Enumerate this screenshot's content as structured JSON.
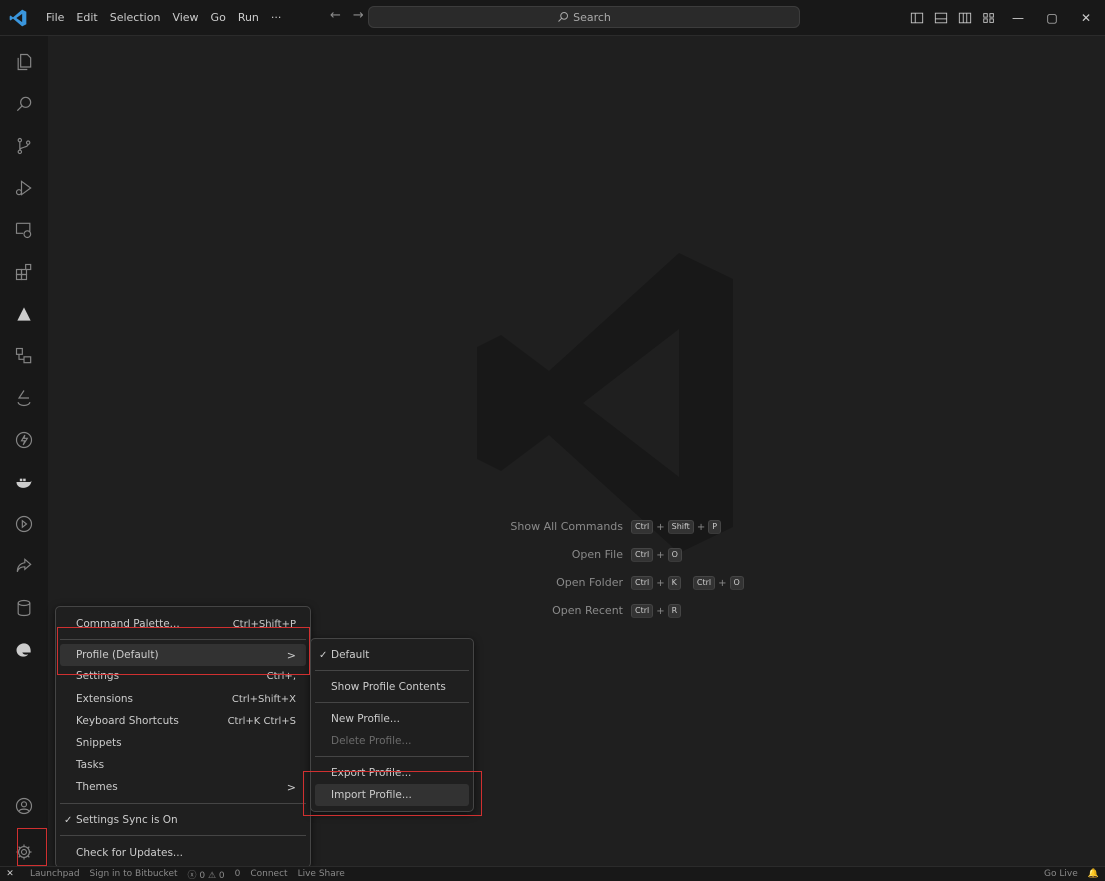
{
  "menubar": {
    "items": [
      "File",
      "Edit",
      "Selection",
      "View",
      "Go",
      "Run",
      "···"
    ],
    "back_arrow": "←",
    "forward_arrow": "→"
  },
  "search": {
    "label": "Search"
  },
  "window_controls": {
    "minimize": "—",
    "maximize": "▢",
    "close": "✕"
  },
  "activity_icons": [
    "explorer-icon",
    "search-icon",
    "source-control-icon",
    "run-debug-icon",
    "remote-explorer-icon",
    "extensions-icon",
    "azure-icon",
    "deployment-icon",
    "accessibility-icon",
    "lightning-icon",
    "docker-icon",
    "play-circle-icon",
    "live-share-icon",
    "database-icon",
    "edge-icon",
    "account-icon",
    "manage-gear-icon"
  ],
  "shortcuts": [
    {
      "label": "Show All Commands",
      "keys": [
        [
          "Ctrl",
          "Shift",
          "P"
        ]
      ]
    },
    {
      "label": "Open File",
      "keys": [
        [
          "Ctrl",
          "O"
        ]
      ]
    },
    {
      "label": "Open Folder",
      "keys": [
        [
          "Ctrl",
          "K"
        ],
        [
          "Ctrl",
          "O"
        ]
      ]
    },
    {
      "label": "Open Recent",
      "keys": [
        [
          "Ctrl",
          "R"
        ]
      ]
    }
  ],
  "manage_menu": {
    "items": [
      {
        "label": "Command Palette...",
        "shortcut": "Ctrl+Shift+P"
      },
      {
        "label": "Profile (Default)",
        "submenu": ">"
      },
      {
        "label": "Settings",
        "shortcut": "Ctrl+,"
      },
      {
        "label": "Extensions",
        "shortcut": "Ctrl+Shift+X"
      },
      {
        "label": "Keyboard Shortcuts",
        "shortcut": "Ctrl+K Ctrl+S"
      },
      {
        "label": "Snippets"
      },
      {
        "label": "Tasks"
      },
      {
        "label": "Themes",
        "submenu": ">"
      },
      {
        "label": "Settings Sync is On",
        "check": "✓"
      },
      {
        "label": "Check for Updates..."
      }
    ]
  },
  "profile_submenu": {
    "items": [
      {
        "label": "Default",
        "check": "✓"
      },
      {
        "label": "Show Profile Contents"
      },
      {
        "label": "New Profile..."
      },
      {
        "label": "Delete Profile...",
        "disabled": true
      },
      {
        "label": "Export Profile..."
      },
      {
        "label": "Import Profile..."
      }
    ]
  },
  "statusbar": {
    "remote": "✕",
    "launchpad": "Launchpad",
    "bitbucket": "Sign in to Bitbucket",
    "problems": "ⓧ 0 ⚠ 0",
    "ports": "0",
    "connect": "Connect",
    "liveshare": "Live Share",
    "golive": "Go Live"
  },
  "colors": {
    "accent": "#3a96dd",
    "highlight_box": "#d03030",
    "background": "#1f1f1f"
  }
}
